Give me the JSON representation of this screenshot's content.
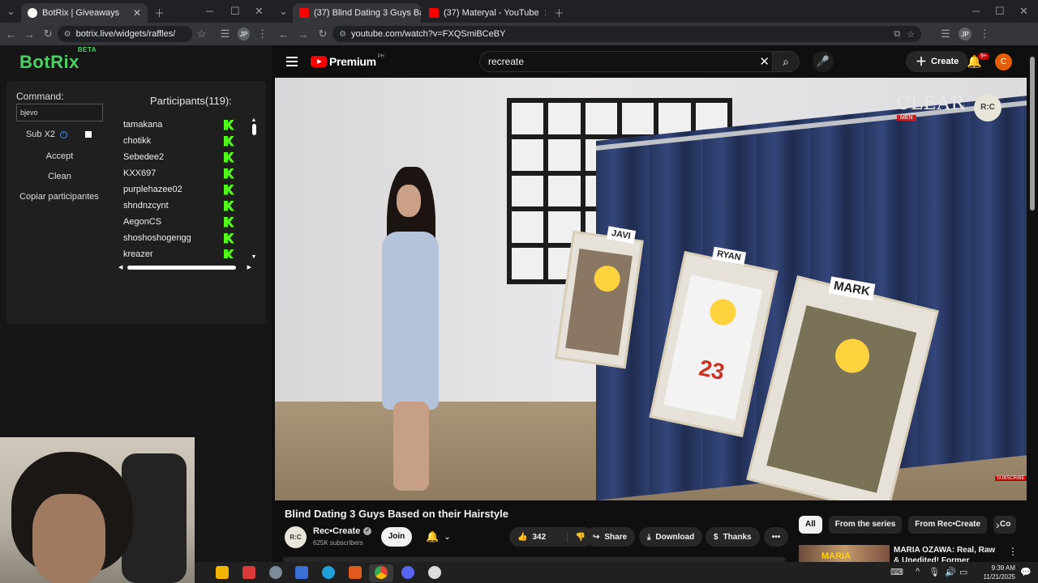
{
  "left_window": {
    "tab_title": "BotRix | Giveaways",
    "url": "botrix.live/widgets/raffles/",
    "profile": "JP"
  },
  "botrix": {
    "brand": "BotRix",
    "brand_badge": "BETA",
    "command_label": "Command:",
    "command_value": "bjevo",
    "sub_label": "Sub X2",
    "accept": "Accept",
    "clean": "Clean",
    "copy": "Copiar participantes",
    "participants_title": "Participants(119):",
    "participants": [
      "tamakana",
      "chotikk",
      "Sebedee2",
      "KXX697",
      "purplehazee02",
      "shndnzcynt",
      "AegonCS",
      "shoshoshogengg",
      "kreazer"
    ]
  },
  "right_window": {
    "tabs": [
      {
        "title": "(37) Blind Dating 3 Guys Ba",
        "active": true
      },
      {
        "title": "(37) Materyal - YouTube",
        "active": false
      }
    ],
    "url": "youtube.com/watch?v=FXQSmiBCeBY",
    "profile": "JP"
  },
  "youtube": {
    "logo_text": "Premium",
    "logo_region": "PH",
    "search_value": "recreate",
    "create_label": "Create",
    "notif_count": "9+",
    "avatar_letter": "C",
    "video_overlay": {
      "brand": "CLEAR",
      "brand_sub": "MEN",
      "x": "x",
      "partner": "R:C",
      "labels": [
        "JAVI",
        "RYAN",
        "MARK"
      ],
      "jersey": "23",
      "watermark": "SUBSCRIBE"
    },
    "video_title": "Blind Dating 3 Guys Based on their Hairstyle",
    "channel": {
      "name": "Rec•Create",
      "avatar": "R:C",
      "subscribers": "625K subscribers",
      "join": "Join"
    },
    "actions": {
      "likes": "342",
      "share": "Share",
      "download": "Download",
      "thanks": "Thanks"
    },
    "chips": [
      "All",
      "From the series",
      "From Rec•Create",
      "Co"
    ],
    "recommendation": {
      "thumb_text": "MARIA",
      "title": "MARIA OZAWA: Real, Raw & Unedited! Former Japanese"
    }
  },
  "taskbar": {
    "time": "9:39 AM",
    "date": "11/21/2025"
  },
  "colors": {
    "brand_green": "#4ad163",
    "kick_green": "#53fc18",
    "yt_red": "#ff0000",
    "avatar_orange": "#e65c00"
  }
}
